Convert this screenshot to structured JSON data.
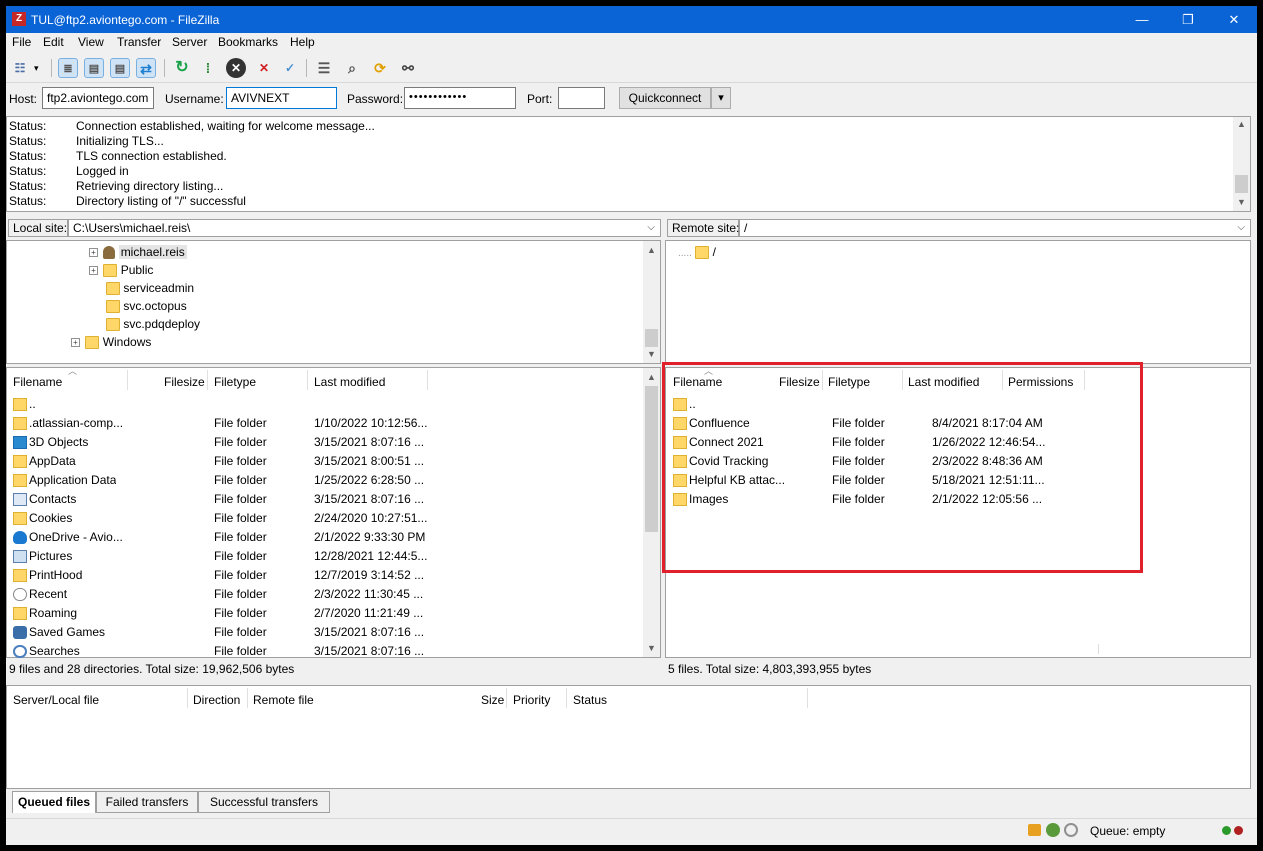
{
  "window": {
    "title": "TUL@ftp2.aviontego.com - FileZilla",
    "app_icon_glyph": "Z",
    "minimize_glyph": "—",
    "restore_glyph": "❐",
    "close_glyph": "✕"
  },
  "menu": [
    "File",
    "Edit",
    "View",
    "Transfer",
    "Server",
    "Bookmarks",
    "Help"
  ],
  "toolbar": {
    "icons": [
      "site-manager-icon",
      "toggle-log-icon",
      "toggle-local-tree-icon",
      "toggle-remote-tree-icon",
      "toggle-queue-icon",
      "refresh-icon",
      "process-queue-icon",
      "cancel-icon",
      "disconnect-icon",
      "reconnect-icon",
      "filter-icon",
      "compare-icon",
      "sync-browse-icon",
      "search-icon"
    ]
  },
  "quickconnect": {
    "host_label": "Host:",
    "host_value": "ftp2.aviontego.com",
    "username_label": "Username:",
    "username_value": "AVIVNEXT",
    "password_label": "Password:",
    "password_value": "••••••••••••",
    "port_label": "Port:",
    "port_value": "",
    "button_label": "Quickconnect",
    "dropdown_glyph": "▾"
  },
  "log": [
    {
      "label": "Status:",
      "text": "Connection established, waiting for welcome message..."
    },
    {
      "label": "Status:",
      "text": "Initializing TLS..."
    },
    {
      "label": "Status:",
      "text": "TLS connection established."
    },
    {
      "label": "Status:",
      "text": "Logged in"
    },
    {
      "label": "Status:",
      "text": "Retrieving directory listing..."
    },
    {
      "label": "Status:",
      "text": "Directory listing of \"/\" successful"
    }
  ],
  "local": {
    "site_label": "Local site:",
    "path": "C:\\Users\\michael.reis\\",
    "tree": [
      {
        "label": "michael.reis",
        "expandable": true,
        "icon": "user-folder-icon",
        "selected": true
      },
      {
        "label": "Public",
        "expandable": true,
        "icon": "folder-icon"
      },
      {
        "label": "serviceadmin",
        "expandable": false,
        "icon": "folder-icon"
      },
      {
        "label": "svc.octopus",
        "expandable": false,
        "icon": "folder-icon"
      },
      {
        "label": "svc.pdqdeploy",
        "expandable": false,
        "icon": "folder-icon"
      },
      {
        "label": "Windows",
        "expandable": true,
        "icon": "folder-icon"
      }
    ],
    "columns": [
      "Filename",
      "Filesize",
      "Filetype",
      "Last modified"
    ],
    "files": [
      {
        "name": "..",
        "size": "",
        "type": "",
        "modified": "",
        "icon": "folder-icon"
      },
      {
        "name": ".atlassian-comp...",
        "size": "",
        "type": "File folder",
        "modified": "1/10/2022 10:12:56...",
        "icon": "folder-icon"
      },
      {
        "name": "3D Objects",
        "size": "",
        "type": "File folder",
        "modified": "3/15/2021 8:07:16 ...",
        "icon": "3d-objects-icon"
      },
      {
        "name": "AppData",
        "size": "",
        "type": "File folder",
        "modified": "3/15/2021 8:00:51 ...",
        "icon": "folder-icon"
      },
      {
        "name": "Application Data",
        "size": "",
        "type": "File folder",
        "modified": "1/25/2022 6:28:50 ...",
        "icon": "folder-icon"
      },
      {
        "name": "Contacts",
        "size": "",
        "type": "File folder",
        "modified": "3/15/2021 8:07:16 ...",
        "icon": "contacts-icon"
      },
      {
        "name": "Cookies",
        "size": "",
        "type": "File folder",
        "modified": "2/24/2020 10:27:51...",
        "icon": "folder-icon"
      },
      {
        "name": "OneDrive - Avio...",
        "size": "",
        "type": "File folder",
        "modified": "2/1/2022 9:33:30 PM",
        "icon": "cloud-icon"
      },
      {
        "name": "Pictures",
        "size": "",
        "type": "File folder",
        "modified": "12/28/2021 12:44:5...",
        "icon": "pictures-icon"
      },
      {
        "name": "PrintHood",
        "size": "",
        "type": "File folder",
        "modified": "12/7/2019 3:14:52 ...",
        "icon": "folder-icon"
      },
      {
        "name": "Recent",
        "size": "",
        "type": "File folder",
        "modified": "2/3/2022 11:30:45 ...",
        "icon": "recent-icon"
      },
      {
        "name": "Roaming",
        "size": "",
        "type": "File folder",
        "modified": "2/7/2020 11:21:49 ...",
        "icon": "folder-icon"
      },
      {
        "name": "Saved Games",
        "size": "",
        "type": "File folder",
        "modified": "3/15/2021 8:07:16 ...",
        "icon": "saved-games-icon"
      },
      {
        "name": "Searches",
        "size": "",
        "type": "File folder",
        "modified": "3/15/2021 8:07:16 ...",
        "icon": "search-icon"
      }
    ],
    "status": "9 files and 28 directories. Total size: 19,962,506 bytes"
  },
  "remote": {
    "site_label": "Remote site:",
    "path": "/",
    "tree": [
      {
        "label": "/",
        "icon": "folder-icon"
      }
    ],
    "columns": [
      "Filename",
      "Filesize",
      "Filetype",
      "Last modified",
      "Permissions"
    ],
    "files": [
      {
        "name": "..",
        "size": "",
        "type": "",
        "modified": "",
        "perms": ""
      },
      {
        "name": "Confluence",
        "size": "",
        "type": "File folder",
        "modified": "8/4/2021 8:17:04 AM",
        "perms": ""
      },
      {
        "name": "Connect 2021",
        "size": "",
        "type": "File folder",
        "modified": "1/26/2022 12:46:54...",
        "perms": ""
      },
      {
        "name": "Covid Tracking",
        "size": "",
        "type": "File folder",
        "modified": "2/3/2022 8:48:36 AM",
        "perms": ""
      },
      {
        "name": "Helpful KB attac...",
        "size": "",
        "type": "File folder",
        "modified": "5/18/2021 12:51:11...",
        "perms": ""
      },
      {
        "name": "Images",
        "size": "",
        "type": "File folder",
        "modified": "2/1/2022 12:05:56 ...",
        "perms": ""
      }
    ],
    "status": "5 files. Total size: 4,803,393,955 bytes",
    "highlight_color": "#e0202a"
  },
  "queue": {
    "columns": [
      "Server/Local file",
      "Direction",
      "Remote file",
      "Size",
      "Priority",
      "Status"
    ],
    "tabs": [
      "Queued files",
      "Failed transfers",
      "Successful transfers"
    ],
    "status_text": "Queue: empty"
  },
  "colors": {
    "titlebar": "#0a64d6",
    "folder": "#ffd768",
    "highlight": "#e0202a"
  }
}
